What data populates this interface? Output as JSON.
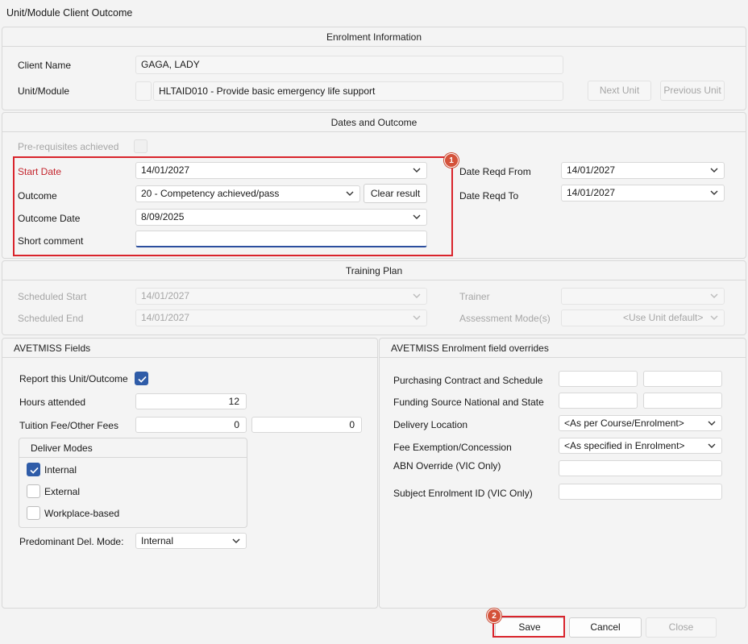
{
  "window": {
    "title": "Unit/Module Client Outcome"
  },
  "enrolment": {
    "header": "Enrolment Information",
    "client_name_label": "Client Name",
    "client_name_value": "GAGA, LADY",
    "unit_label": "Unit/Module",
    "unit_value": "HLTAID010 - Provide basic emergency life support",
    "next_unit": "Next Unit",
    "previous_unit": "Previous Unit"
  },
  "dates": {
    "header": "Dates and Outcome",
    "prereq_label": "Pre-requisites achieved",
    "start_date_label": "Start Date",
    "start_date_value": "14/01/2027",
    "outcome_label": "Outcome",
    "outcome_value": "20 - Competency achieved/pass",
    "clear_result": "Clear result",
    "outcome_date_label": "Outcome Date",
    "outcome_date_value": "8/09/2025",
    "short_comment_label": "Short comment",
    "short_comment_value": "",
    "date_reqd_from_label": "Date Reqd From",
    "date_reqd_from_value": "14/01/2027",
    "date_reqd_to_label": "Date Reqd To",
    "date_reqd_to_value": "14/01/2027"
  },
  "training": {
    "header": "Training Plan",
    "scheduled_start_label": "Scheduled Start",
    "scheduled_start_value": "14/01/2027",
    "scheduled_end_label": "Scheduled End",
    "scheduled_end_value": "14/01/2027",
    "trainer_label": "Trainer",
    "trainer_value": "",
    "assessment_mode_label": "Assessment Mode(s)",
    "assessment_mode_value": "<Use Unit default>"
  },
  "avetmiss": {
    "header": "AVETMISS Fields",
    "report_label": "Report this Unit/Outcome",
    "report_checked": true,
    "hours_label": "Hours attended",
    "hours_value": "12",
    "tuition_label": "Tuition Fee/Other Fees",
    "tuition_value": "0",
    "other_fees_value": "0",
    "deliver_modes_header": "Deliver Modes",
    "modes": [
      {
        "label": "Internal",
        "checked": true
      },
      {
        "label": "External",
        "checked": false
      },
      {
        "label": "Workplace-based",
        "checked": false
      }
    ],
    "predominant_label": "Predominant Del. Mode:",
    "predominant_value": "Internal"
  },
  "overrides": {
    "header": "AVETMISS Enrolment field overrides",
    "purchasing_label": "Purchasing Contract and Schedule",
    "funding_label": "Funding Source National and State",
    "delivery_location_label": "Delivery Location",
    "delivery_location_value": "<As per Course/Enrolment>",
    "fee_exemption_label": "Fee Exemption/Concession",
    "fee_exemption_value": "<As specified in Enrolment>",
    "abn_label": "ABN Override (VIC Only)",
    "subject_enrolment_label": "Subject Enrolment ID (VIC Only)"
  },
  "footer": {
    "save": "Save",
    "cancel": "Cancel",
    "close": "Close"
  },
  "annotations": {
    "badge1": "1",
    "badge2": "2"
  },
  "colors": {
    "accent": "#2f5ca8",
    "highlight_red": "#d9242c",
    "badge": "#d4523a"
  }
}
